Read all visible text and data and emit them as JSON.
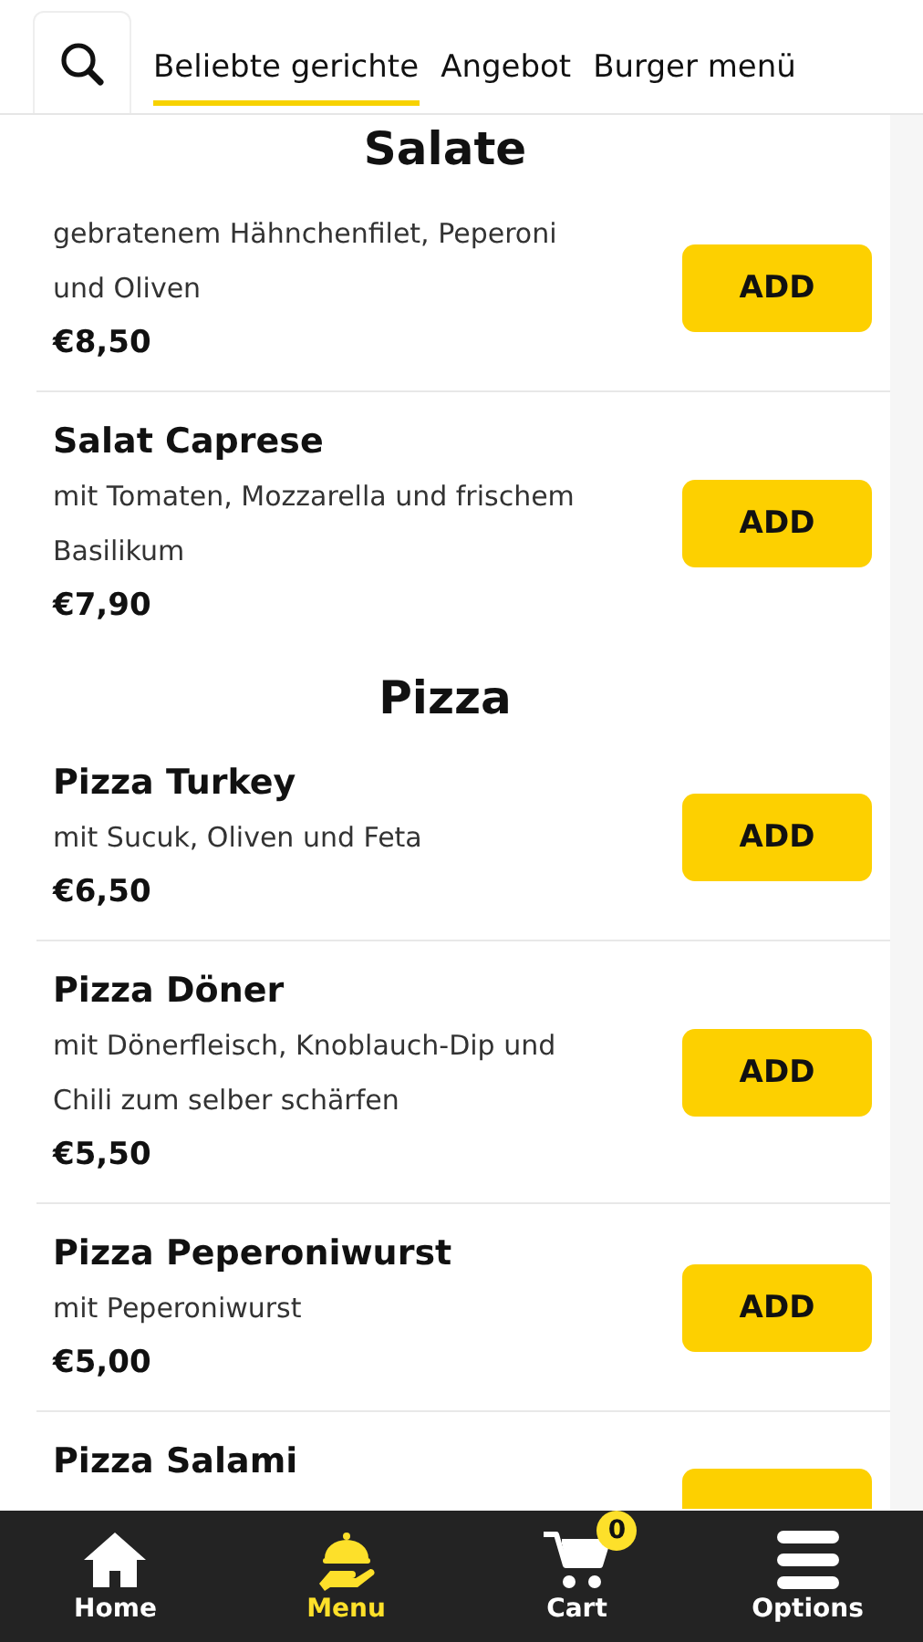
{
  "tabs": [
    {
      "label": "Beliebte gerichte",
      "selected": true
    },
    {
      "label": "Angebot",
      "selected": false
    },
    {
      "label": "Burger menü",
      "selected": false
    }
  ],
  "sections": [
    {
      "title": "Salate",
      "items": [
        {
          "kind": "full",
          "description": "gebratenem Hähnchenfilet, Peperoni und Oliven",
          "price": "€8,50",
          "button": "ADD"
        },
        {
          "kind": "full",
          "name": "Salat Caprese",
          "description": "mit Tomaten, Mozzarella und frischem Basilikum",
          "price": "€7,90",
          "button": "ADD"
        }
      ]
    },
    {
      "title": "Pizza",
      "items": [
        {
          "kind": "full",
          "name": "Pizza Turkey",
          "description": "mit Sucuk, Oliven und Feta",
          "price": "€6,50",
          "button": "ADD"
        },
        {
          "kind": "full",
          "name": "Pizza Döner",
          "description": "mit Dönerfleisch, Knoblauch-Dip und Chili zum selber schärfen",
          "price": "€5,50",
          "button": "ADD"
        },
        {
          "kind": "full",
          "name": "Pizza Peperoniwurst",
          "description": "mit Peperoniwurst",
          "price": "€5,00",
          "button": "ADD"
        },
        {
          "kind": "clipped",
          "name": "Pizza Salami"
        }
      ]
    }
  ],
  "nav": [
    {
      "kind": "home",
      "label": "Home",
      "selected": false
    },
    {
      "kind": "menu",
      "label": "Menu",
      "selected": true
    },
    {
      "kind": "cart",
      "label": "Cart",
      "selected": false,
      "badge": "0"
    },
    {
      "kind": "options",
      "label": "Options",
      "selected": false
    }
  ]
}
